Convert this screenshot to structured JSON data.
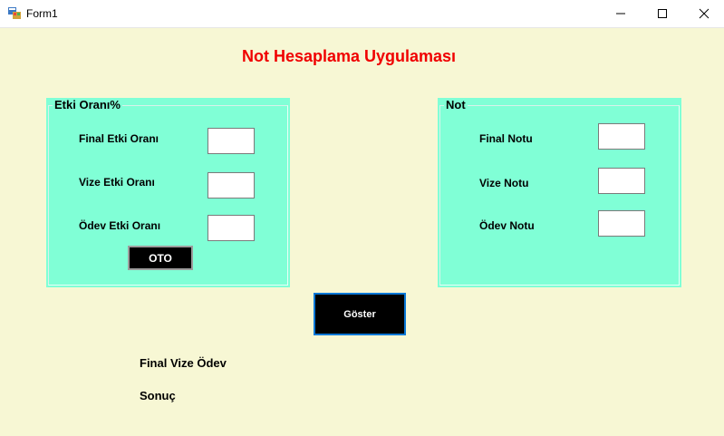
{
  "window": {
    "title": "Form1",
    "icon": "winforms-app-icon",
    "controls": [
      "minimize-icon",
      "maximize-icon",
      "close-icon"
    ]
  },
  "heading": "Not Hesaplama Uygulaması",
  "colors": {
    "form_background": "#f7f7d4",
    "groupbox_background": "#80ffd6",
    "heading": "#f00000",
    "button_background": "#000000",
    "focus_border": "#0a78d7"
  },
  "weights_group": {
    "title": "Etki Oranı%",
    "fields": [
      {
        "label": "Final Etki Oranı",
        "value": ""
      },
      {
        "label": "Vize Etki Oranı",
        "value": ""
      },
      {
        "label": "Ödev Etki Oranı",
        "value": ""
      }
    ],
    "auto_button": "OTO"
  },
  "grades_group": {
    "title": "Not",
    "fields": [
      {
        "label": "Final Notu",
        "value": ""
      },
      {
        "label": "Vize Notu",
        "value": ""
      },
      {
        "label": "Ödev Notu",
        "value": ""
      }
    ]
  },
  "show_button": "Göster",
  "results": {
    "breakdown": "Final Vize Ödev",
    "total": "Sonuç"
  }
}
